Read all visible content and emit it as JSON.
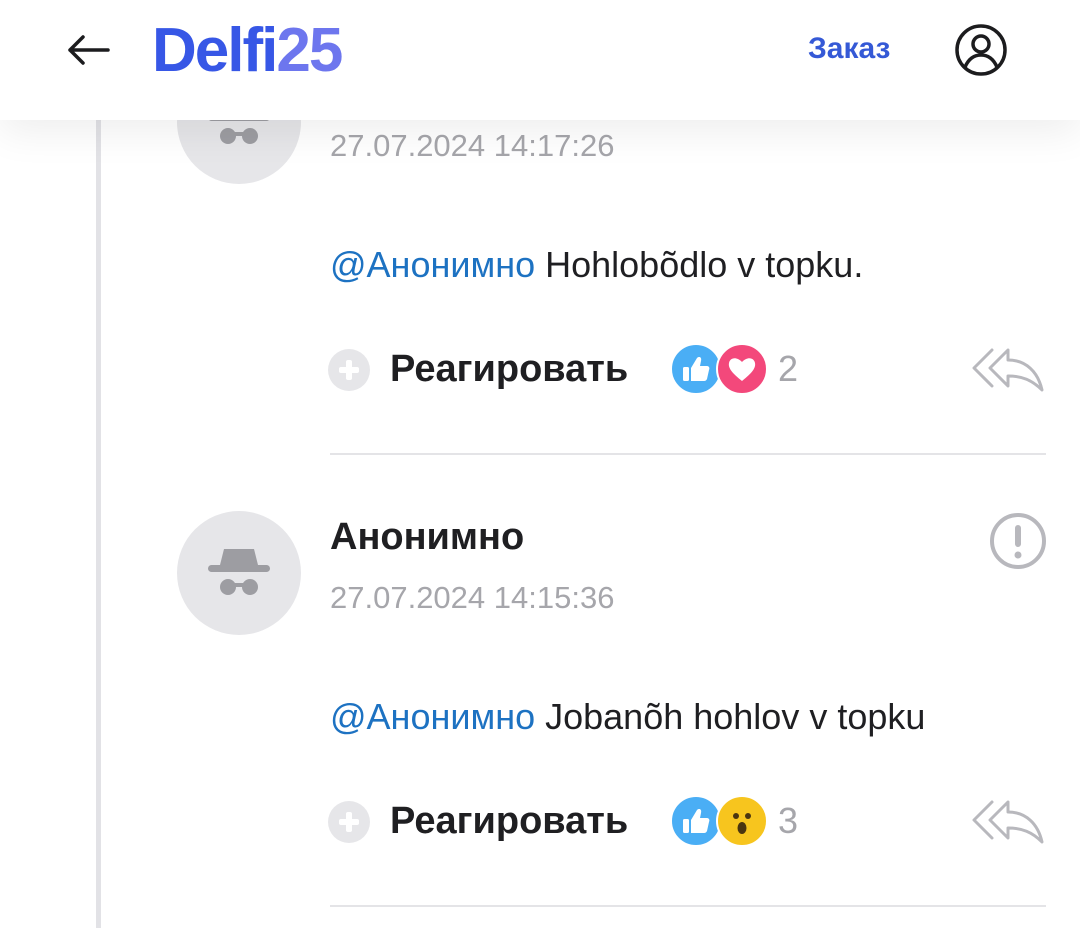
{
  "header": {
    "logo_main": "Delfi",
    "logo_num": "25",
    "order_label": "Заказ",
    "back_icon": "arrow-left-icon",
    "profile_icon": "user-circle-icon"
  },
  "colors": {
    "brand": "#3757e6",
    "link": "#1d72c2",
    "like": "#4aaef5",
    "heart": "#f3487b",
    "wow": "#f7c51e"
  },
  "comments": [
    {
      "author": "",
      "timestamp": "27.07.2024 14:17:26",
      "mention": "@Анонимно",
      "text": " Hohlobõdlo v topku.",
      "react_label": "Реагировать",
      "reactions": [
        "like",
        "heart"
      ],
      "reaction_count": "2"
    },
    {
      "author": "Анонимно",
      "timestamp": "27.07.2024 14:15:36",
      "mention": "@Анонимно",
      "text": " Jobanõh hohlov v topku",
      "react_label": "Реагировать",
      "reactions": [
        "like",
        "wow"
      ],
      "reaction_count": "3"
    }
  ]
}
